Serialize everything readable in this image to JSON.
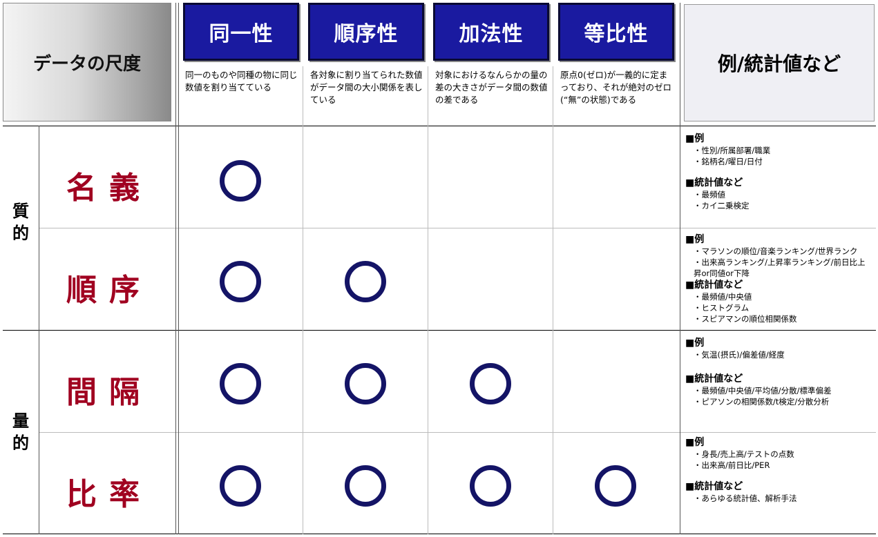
{
  "corner_label": "データの尺度",
  "properties": [
    {
      "title": "同一性",
      "desc": "同一のものや同種の物に同じ数値を割り当てている"
    },
    {
      "title": "順序性",
      "desc": "各対象に割り当てられた数値がデータ間の大小関係を表している"
    },
    {
      "title": "加法性",
      "desc": "対象におけるなんらかの量の差の大きさがデータ間の数値の差である"
    },
    {
      "title": "等比性",
      "desc": "原点0(ゼロ)が一義的に定まっており、それが絶対のゼロ(“無”の状態)である"
    }
  ],
  "examples_header": "例/統計値など",
  "categories": [
    {
      "label": "質的"
    },
    {
      "label": "量的"
    }
  ],
  "scales": [
    {
      "name": "名義",
      "marks": [
        true,
        false,
        false,
        false
      ],
      "example_title": "■例",
      "examples": [
        "・性別/所属部署/職業",
        "・銘柄名/曜日/日付"
      ],
      "stats_title": "■統計値など",
      "stats": [
        "・最頻値",
        "・カイ二乗検定"
      ]
    },
    {
      "name": "順序",
      "marks": [
        true,
        true,
        false,
        false
      ],
      "example_title": "■例",
      "examples": [
        "・マラソンの順位/音楽ランキング/世界ランク",
        "・出来高ランキング/上昇率ランキング/前日比上昇or同値or下降"
      ],
      "stats_title": "■統計値など",
      "stats": [
        "・最頻値/中央値",
        "・ヒストグラム",
        "・スピアマンの順位相関係数"
      ]
    },
    {
      "name": "間隔",
      "marks": [
        true,
        true,
        true,
        false
      ],
      "example_title": "■例",
      "examples": [
        "・気温(摂氏)/偏差値/経度"
      ],
      "stats_title": "■統計値など",
      "stats": [
        "・最頻値/中央値/平均値/分散/標準偏差",
        "・ピアソンの相関係数/t検定/分散分析"
      ]
    },
    {
      "name": "比率",
      "marks": [
        true,
        true,
        true,
        true
      ],
      "example_title": "■例",
      "examples": [
        "・身長/売上高/テストの点数",
        "・出来高/前日比/PER"
      ],
      "stats_title": "■統計値など",
      "stats": [
        "・あらゆる統計値、解析手法"
      ]
    }
  ],
  "colors": {
    "header_blue": "#1a1aa0",
    "scale_red": "#a00020",
    "circle_navy": "#141466"
  }
}
